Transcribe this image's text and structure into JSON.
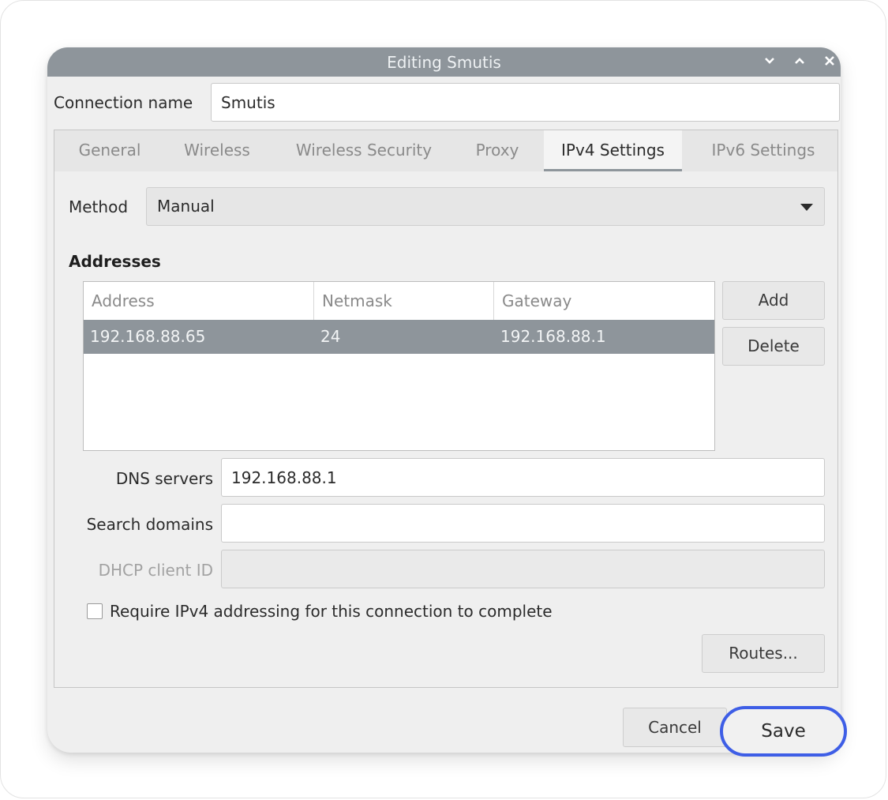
{
  "window": {
    "title": "Editing Smutis",
    "controls": [
      "chevron-down-icon",
      "chevron-up-icon",
      "close-icon"
    ]
  },
  "connection": {
    "label": "Connection name",
    "value": "Smutis"
  },
  "tabs": [
    {
      "label": "General",
      "active": false
    },
    {
      "label": "Wireless",
      "active": false
    },
    {
      "label": "Wireless Security",
      "active": false
    },
    {
      "label": "Proxy",
      "active": false
    },
    {
      "label": "IPv4 Settings",
      "active": true
    },
    {
      "label": "IPv6 Settings",
      "active": false
    }
  ],
  "ipv4": {
    "method_label": "Method",
    "method_value": "Manual",
    "addresses_heading": "Addresses",
    "columns": [
      "Address",
      "Netmask",
      "Gateway"
    ],
    "rows": [
      {
        "address": "192.168.88.65",
        "netmask": "24",
        "gateway": "192.168.88.1",
        "selected": true
      }
    ],
    "add_label": "Add",
    "delete_label": "Delete",
    "dns_label": "DNS servers",
    "dns_value": "192.168.88.1",
    "search_label": "Search domains",
    "search_value": "",
    "dhcp_label": "DHCP client ID",
    "dhcp_value": "",
    "require_label": "Require IPv4 addressing for this connection to complete",
    "require_checked": false,
    "routes_label": "Routes..."
  },
  "footer": {
    "cancel_label": "Cancel",
    "save_label": "Save"
  },
  "colors": {
    "titlebar": "#8e959b",
    "selection": "#8e959b",
    "highlight_ring": "#3e5ee6"
  }
}
